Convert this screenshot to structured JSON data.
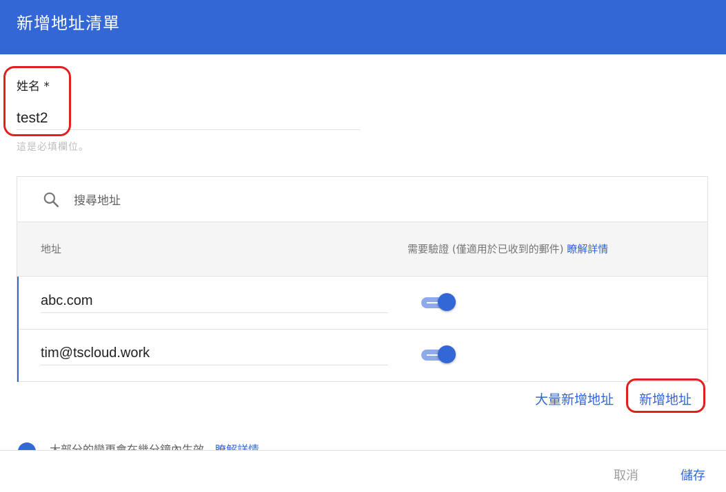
{
  "header": {
    "title": "新增地址清單"
  },
  "form": {
    "name_label": "姓名 *",
    "name_value": "test2",
    "helper_text": "這是必填欄位。"
  },
  "search": {
    "placeholder": "搜尋地址"
  },
  "table": {
    "col_address": "地址",
    "col_verify": "需要驗證 (僅適用於已收到的郵件)",
    "col_verify_link": "瞭解詳情",
    "rows": [
      {
        "address": "abc.com",
        "verify": true
      },
      {
        "address": "tim@tscloud.work",
        "verify": true
      }
    ]
  },
  "actions": {
    "bulk_add": "大量新增地址",
    "add_address": "新增地址"
  },
  "info": {
    "text": "大部分的變更會在幾分鐘內生效。",
    "link": "瞭解詳情"
  },
  "footer": {
    "cancel": "取消",
    "save": "儲存"
  },
  "colors": {
    "accent": "#3367d6",
    "highlight": "#e0201f"
  },
  "icons": {
    "search": "search-icon",
    "info": "info-icon"
  }
}
